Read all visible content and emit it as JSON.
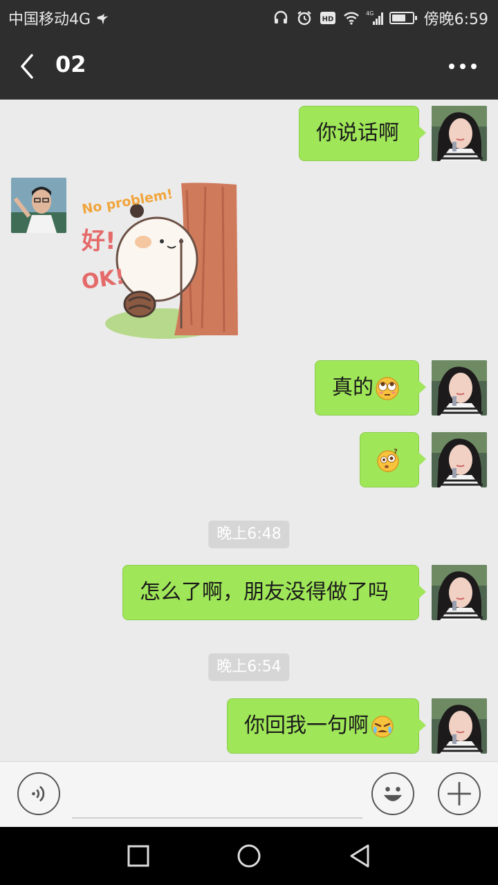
{
  "status_bar": {
    "carrier": "中国移动4G",
    "time": "傍晚6:59",
    "network": "4G",
    "battery_level": 0.7
  },
  "header": {
    "title": "02",
    "back_icon": "chevron-left-icon",
    "more_icon": "more-horizontal-icon"
  },
  "messages": [
    {
      "side": "right",
      "type": "text",
      "text": "你说话啊"
    },
    {
      "side": "left",
      "type": "sticker",
      "sticker_text": [
        "No problem!",
        "好!",
        "OK!"
      ]
    },
    {
      "side": "right",
      "type": "text",
      "text": "真的",
      "emoji": "rolling-eyes-emoji"
    },
    {
      "side": "right",
      "type": "emoji",
      "emoji": "confused-emoji"
    },
    {
      "type": "time",
      "text": "晚上6:48"
    },
    {
      "side": "right",
      "type": "text",
      "text": "怎么了啊，朋友没得做了吗"
    },
    {
      "type": "time",
      "text": "晚上6:54"
    },
    {
      "side": "right",
      "type": "text",
      "text": "你回我一句啊",
      "emoji": "crying-emoji"
    }
  ],
  "input_bar": {
    "voice_icon": "voice-icon",
    "emoji_icon": "smiley-icon",
    "plus_icon": "plus-icon",
    "value": ""
  },
  "colors": {
    "bubble": "#9fe658",
    "header_bg": "#2e2e2e",
    "chat_bg": "#ebebeb"
  }
}
